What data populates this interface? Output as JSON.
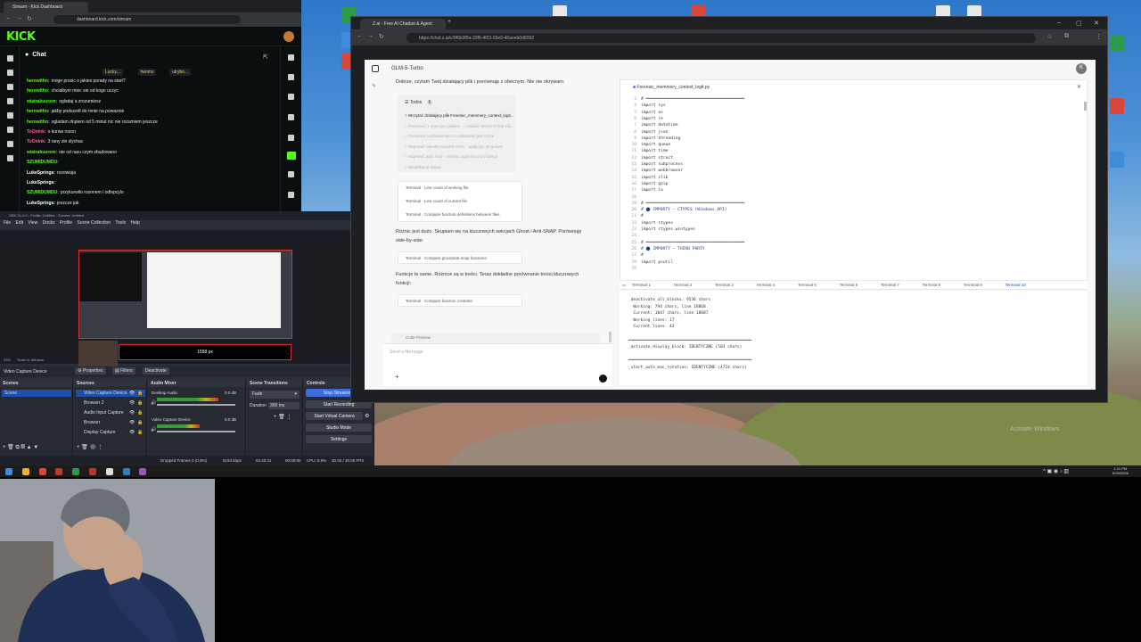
{
  "kick": {
    "tab_title": "Stream - Kick Dashboard",
    "url": "dashboard.kick.com/stream",
    "logo": "KICK",
    "chat_title": "Chat",
    "top_users": [
      "Lucky...",
      "twoms",
      "utrybo..."
    ],
    "messages": [
      {
        "user": "herowithn:",
        "text": "moge prosic o jakies porady na start?",
        "color": "#53fc18"
      },
      {
        "user": "herowithn:",
        "text": "chcialbym miec sie od kogo uczyc",
        "color": "#53fc18"
      },
      {
        "user": "wiatrakuurem:",
        "text": "ogladaj a zrozumiesz",
        "color": "#53fc18"
      },
      {
        "user": "herowithn:",
        "text": "jakby podszedl do mnie na powaznie",
        "color": "#53fc18"
      },
      {
        "user": "herowithn:",
        "text": "ogladam dopiero od 5 minut nic nie rozumiem jeszcze",
        "color": "#53fc18"
      },
      {
        "user": "ToOnInk:",
        "text": "o kurwa rozon",
        "color": "#ff5aa0"
      },
      {
        "user": "ToOnInk:",
        "text": "3 rany zle slychac",
        "color": "#ff5aa0"
      },
      {
        "user": "wiatrakuurem:",
        "text": "nie od razu czym zbudowano",
        "color": "#53fc18"
      },
      {
        "user": "SZUMIDUMDU:",
        "text": "",
        "color": "#53fc18"
      },
      {
        "user": "LukeSprings:",
        "text": "rozowiaja",
        "color": "#ffffff"
      },
      {
        "user": "LukeSprings:",
        "text": "",
        "color": "#ffffff"
      },
      {
        "user": "SZUMIDUMDU:",
        "text": "przykurwilo rozonem i odlepcylo",
        "color": "#53fc18"
      },
      {
        "user": "LukeSprings:",
        "text": "jeszcze jak",
        "color": "#ffffff"
      }
    ]
  },
  "obs": {
    "title": "OBS 31.0.0 - Profile: Untitled - Scenes: Untitled",
    "menu": [
      "File",
      "Edit",
      "View",
      "Docks",
      "Profile",
      "Scene Collection",
      "Tools",
      "Help"
    ],
    "preview_label": "1558 px",
    "zoom": "33%",
    "scale_mode": "Scale to Window",
    "source_label": "Video Capture Device",
    "source_buttons": [
      "Properties",
      "Filters",
      "Deactivate"
    ],
    "docks": {
      "scenes": "Scenes",
      "sources": "Sources",
      "audio": "Audio Mixer",
      "transitions": "Scene Transitions",
      "controls": "Controls"
    },
    "scenes": [
      "Scene"
    ],
    "sources": [
      "Video Capture Device",
      "Browser 2",
      "Audio Input Capture",
      "Browser",
      "Display Capture"
    ],
    "audio": [
      {
        "name": "Desktop Audio",
        "db": "0.0 dB",
        "level": 0.78
      },
      {
        "name": "Video Capture Device",
        "db": "0.0 dB",
        "level": 0.55
      }
    ],
    "transition": "Fade",
    "duration_label": "Duration",
    "duration": "300 ms",
    "controls": [
      "Stop Streaming",
      "Start Recording",
      "Start Virtual Camera",
      "Studio Mode",
      "Settings"
    ],
    "status": {
      "dropped": "Dropped Frames 0 (0.0%)",
      "kbps": "8193 kbps",
      "live": "02:40:31",
      "rec": "00:00:00",
      "cpu": "CPU: 8.5%",
      "fps": "30.00 / 30.00 FPS"
    }
  },
  "zwin": {
    "tab_title": "Z.ai - Free AI Chatbot & Agent",
    "url": "https://chat.z.ai/c/9f6b3f9a-33f6-4f23-93e9-40aeeb0d6092",
    "model": "GLM-5-Turbo",
    "avatar": "K",
    "intro": "Dobrze, czytam Twój działający plik i porównuję z obecnym. Nie nie okrywam.",
    "todos_label": "Todos",
    "todos_count": "6",
    "todos": [
      {
        "text": "Wczytać działający plik Forensic_memmory_context_logit...",
        "done": false
      },
      {
        "text": "Porównać z obecnym plikiem — znaleźć WSZYSTKIE róż...",
        "done": true
      },
      {
        "text": "Porównać uzdrowieniem co dokładnie jest różne",
        "done": true
      },
      {
        "text": "Naprawić rejestry nazwisk MAC - wyłączyć 40 grawer",
        "done": true
      },
      {
        "text": "Naprawić auto loop - zmiana organizacji po funkcji",
        "done": true
      },
      {
        "text": "Weryfikacja syntax",
        "done": true
      }
    ],
    "terminals": [
      "Terminal · Line count of working file",
      "Terminal · Line count of current file",
      "Terminal · Compare function definitions between files"
    ],
    "para2": [
      "Różnic jest dużo. Skupiam się na kluczowych sekcjach Ghost i Anti-SNAP. Porównuję",
      "side-by-side:"
    ],
    "term2": "Terminal · Compare ghost/anti-snap functions",
    "para3": [
      "Funkcje te same. Różnice są w treści. Teraz dokładne porównanie treści kluczowych",
      "funkcji:"
    ],
    "term3": "Terminal · Compare function contents",
    "code_preview_label": "Code Preview",
    "input_placeholder": "Send a Message",
    "file_name": "Forensic_memmory_context_logit.py",
    "code_lines": [
      {
        "n": "3",
        "c": "# ════════════════════════════════════════"
      },
      {
        "n": "4",
        "c": "import sys"
      },
      {
        "n": "5",
        "c": "import os"
      },
      {
        "n": "6",
        "c": "import re"
      },
      {
        "n": "7",
        "c": "import datetime"
      },
      {
        "n": "8",
        "c": "import json"
      },
      {
        "n": "9",
        "c": "import threading"
      },
      {
        "n": "10",
        "c": "import queue"
      },
      {
        "n": "11",
        "c": "import time"
      },
      {
        "n": "12",
        "c": "import struct"
      },
      {
        "n": "13",
        "c": "import subprocess"
      },
      {
        "n": "14",
        "c": "import webbrowser"
      },
      {
        "n": "15",
        "c": "import zlib"
      },
      {
        "n": "16",
        "c": "import gzip"
      },
      {
        "n": "17",
        "c": "import io"
      },
      {
        "n": "18",
        "c": ""
      },
      {
        "n": "19",
        "c": "# ════════════════════════════════════════"
      },
      {
        "n": "20",
        "c": "# ⬤ IMPORTY — CTYPES (Windows API)"
      },
      {
        "n": "21",
        "c": "#"
      },
      {
        "n": "22",
        "c": "import ctypes"
      },
      {
        "n": "23",
        "c": "import ctypes.wintypes"
      },
      {
        "n": "24",
        "c": ""
      },
      {
        "n": "25",
        "c": "# ════════════════════════════════════════"
      },
      {
        "n": "26",
        "c": "# ⬤ IMPORTY — THIRD PARTY"
      },
      {
        "n": "27",
        "c": "#"
      },
      {
        "n": "28",
        "c": "import psutil"
      },
      {
        "n": "29",
        "c": ""
      }
    ],
    "terminal_tabs": [
      "Terminal 1",
      "Terminal 2",
      "Terminal 3",
      "Terminal 4",
      "Terminal 5",
      "Terminal 6",
      "Terminal 7",
      "Terminal 8",
      "Terminal 9",
      "Terminal 10"
    ],
    "terminal_output": [
      "_deactivate_all_blocks: 9536 chars",
      "  Working: 794 chars, line 18868",
      "  Current: 1047 chars, line 18687",
      "  Working lines: 17",
      "  Current lines: 43",
      "",
      "═══════════════════════════════════════════════════",
      "_activate_display_block: IDENTYCZNE (583 chars)",
      "",
      "═══════════════════════════════════════════════════",
      "_start_auto_mac_rotation: IDENTYCZNE (4724 chars)"
    ]
  },
  "taskbar": {
    "time": "1:11 PM",
    "date": "5/29/2026"
  },
  "desktop": {
    "watermark": "Activate Windows"
  }
}
